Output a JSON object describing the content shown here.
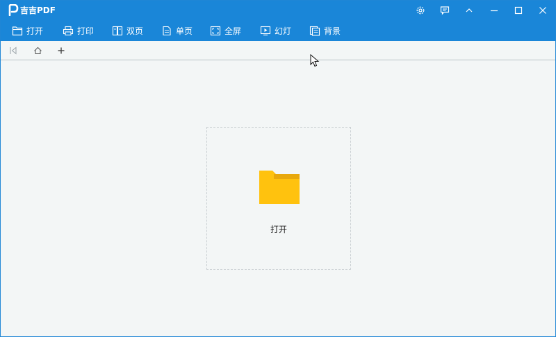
{
  "app": {
    "title": "吉吉PDF"
  },
  "titlebar": {
    "icons": [
      "gear-icon",
      "feedback-icon",
      "collapse-icon",
      "minimize-icon",
      "maximize-icon",
      "close-icon"
    ]
  },
  "toolbar": {
    "open_label": "打开",
    "print_label": "打印",
    "double_page_label": "双页",
    "single_page_label": "单页",
    "fullscreen_label": "全屏",
    "slideshow_label": "幻灯",
    "background_label": "背景"
  },
  "tabbar": {
    "icons": [
      "sidebar-collapse-icon",
      "home-icon",
      "plus-icon"
    ]
  },
  "main": {
    "open_label": "打开"
  },
  "colors": {
    "accent": "#1a86d8",
    "background": "#f3f6f6",
    "folder": "#ffc20e",
    "folder_tab": "#e8a80c"
  }
}
